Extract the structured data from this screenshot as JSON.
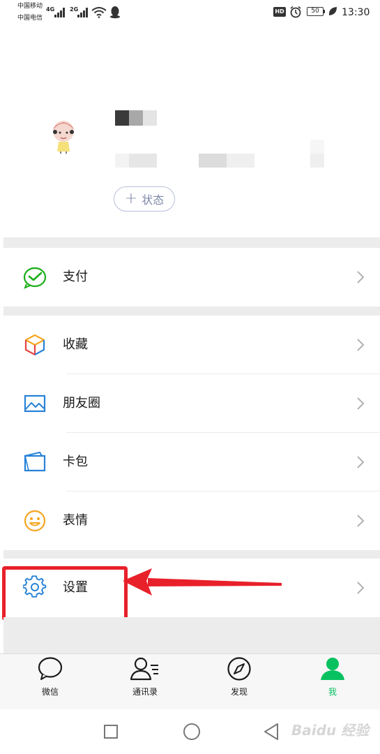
{
  "status_bar": {
    "carrier1": "中国移动",
    "carrier2": "中国电信",
    "net1": "4G",
    "net2": "2G",
    "hd": "HD",
    "battery": "50",
    "time": "13:30"
  },
  "profile": {
    "status_label": "状态",
    "status_plus": "+"
  },
  "menu": {
    "pay": "支付",
    "favorites": "收藏",
    "moments": "朋友圈",
    "cards": "卡包",
    "stickers": "表情",
    "settings": "设置"
  },
  "tabs": [
    {
      "label": "微信"
    },
    {
      "label": "通讯录"
    },
    {
      "label": "发现"
    },
    {
      "label": "我"
    }
  ],
  "colors": {
    "accent": "#07c160",
    "highlight": "#e8202a",
    "gap": "#ececec"
  },
  "watermark": "Baidu 经验"
}
